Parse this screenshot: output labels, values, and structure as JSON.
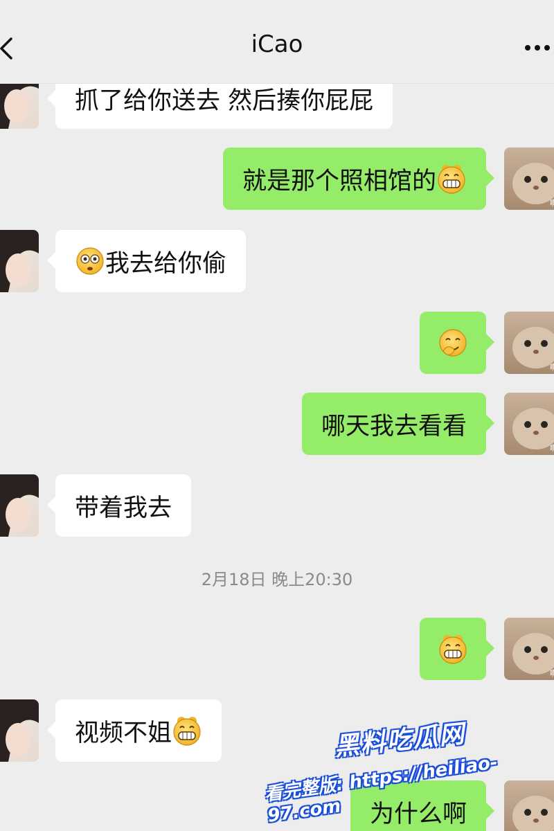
{
  "header": {
    "title": "iCao",
    "back_icon": "chevron-left-icon",
    "more_icon": "more-dots-icon"
  },
  "messages": [
    {
      "side": "in",
      "text": "抓了给你送去 然后揍你屁屁"
    },
    {
      "side": "out",
      "text": "就是那个照相馆的",
      "emoji_after": "grin"
    },
    {
      "side": "in",
      "text": "我去给你偷",
      "emoji_before": "worried"
    },
    {
      "side": "out",
      "text": "",
      "emoji_after": "facepalm-smile"
    },
    {
      "side": "out",
      "text": "哪天我去看看"
    },
    {
      "side": "in",
      "text": "带着我去"
    },
    {
      "side": "out",
      "text": "",
      "emoji_after": "grin"
    },
    {
      "side": "in",
      "text": "视频不姐",
      "emoji_after": "grin"
    },
    {
      "side": "out",
      "text": "为什么啊"
    }
  ],
  "timestamp": "2月18日 晚上20:30",
  "avatar_caption": "啊?",
  "watermark": {
    "title": "黑料吃瓜网",
    "line": "看完整版: https://heiliao-97.com"
  },
  "colors": {
    "background": "#ededed",
    "bubble_in": "#ffffff",
    "bubble_out": "#95ec69",
    "watermark_outline": "#1b4fd8"
  }
}
